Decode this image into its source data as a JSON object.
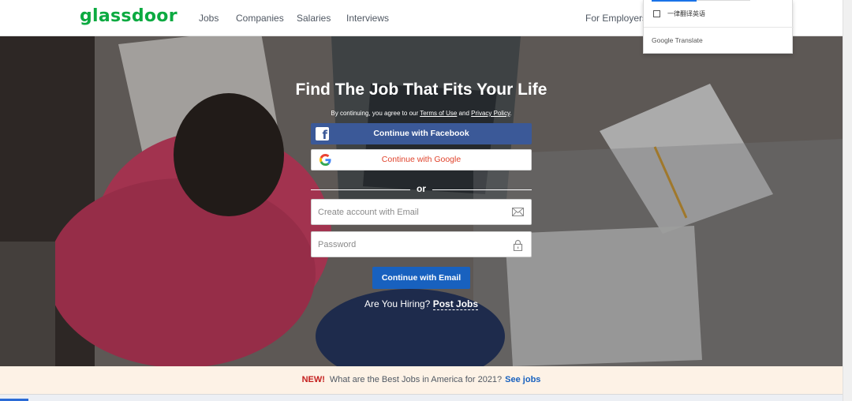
{
  "header": {
    "logo": "glassdoor",
    "nav": [
      "Jobs",
      "Companies",
      "Salaries",
      "Interviews"
    ],
    "employers_link": "For Employers"
  },
  "translate_popup": {
    "checkbox_label": "一律翻译英语",
    "brand": "Google",
    "brand_suffix": "Translate"
  },
  "hero": {
    "title": "Find The Job That Fits Your Life",
    "terms_prefix": "By continuing, you agree to our",
    "terms_link": "Terms of Use",
    "terms_and": "and",
    "privacy_link": "Privacy Policy",
    "terms_suffix": ".",
    "facebook_button": "Continue with Facebook",
    "google_button": "Continue with Google",
    "or": "or",
    "email_placeholder": "Create account with Email",
    "password_placeholder": "Password",
    "email_button": "Continue with Email",
    "hiring_text": "Are You Hiring?",
    "post_jobs": "Post Jobs"
  },
  "promo": {
    "badge": "NEW!",
    "text": "What are the Best Jobs in America for 2021?",
    "link": "See jobs"
  },
  "colors": {
    "brand_green": "#0caa41",
    "facebook_blue": "#3b5998",
    "google_red": "#e0442d",
    "primary_blue": "#1861bf",
    "promo_bg": "#fdf2e6",
    "new_red": "#c4201f"
  }
}
